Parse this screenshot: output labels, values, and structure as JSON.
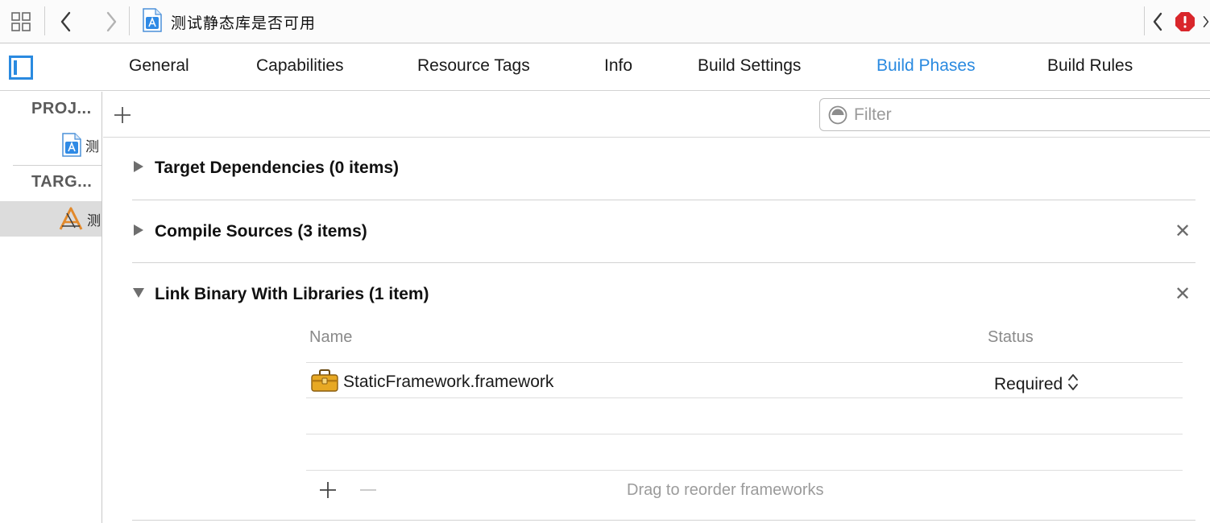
{
  "breadcrumb": {
    "project_name": "测试静态库是否可用"
  },
  "tabs": [
    {
      "label": "General"
    },
    {
      "label": "Capabilities"
    },
    {
      "label": "Resource Tags"
    },
    {
      "label": "Info"
    },
    {
      "label": "Build Settings"
    },
    {
      "label": "Build Phases",
      "active": true
    },
    {
      "label": "Build Rules"
    }
  ],
  "sidebar": {
    "project_header": "PROJ...",
    "project_item": "测",
    "targets_header": "TARG...",
    "target_item": "测"
  },
  "filter": {
    "placeholder": "Filter"
  },
  "phases": {
    "target_dependencies": "Target Dependencies (0 items)",
    "compile_sources": "Compile Sources (3 items)",
    "link_binary": "Link Binary With Libraries (1 item)"
  },
  "library_table": {
    "name_header": "Name",
    "status_header": "Status",
    "rows": [
      {
        "name": "StaticFramework.framework",
        "status": "Required"
      }
    ],
    "footer_hint": "Drag to reorder frameworks"
  },
  "icons": {
    "grid": "grid-icon",
    "back": "chevron-left-icon",
    "forward": "chevron-right-icon",
    "project_file": "xcode-project-file-icon",
    "error": "error-badge-icon",
    "sidebar_toggle": "sidebar-toggle-icon",
    "add": "plus-icon",
    "filter": "filter-icon",
    "disclosure_collapsed": "disclosure-triangle-right-icon",
    "disclosure_expanded": "disclosure-triangle-down-icon",
    "remove": "close-icon",
    "framework": "framework-toolbox-icon",
    "stepper": "up-down-chevron-icon",
    "minus": "minus-icon",
    "target_app": "app-target-icon"
  },
  "colors": {
    "accent": "#2a8ae0",
    "error": "#d9262b",
    "selection": "#dcdcdc"
  }
}
